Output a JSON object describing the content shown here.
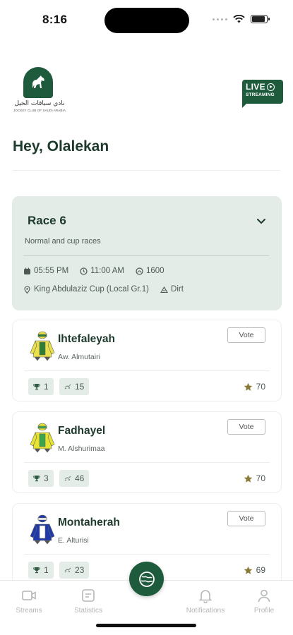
{
  "status_bar": {
    "time": "8:16",
    "battery_level": 0.9
  },
  "header": {
    "logo_arabic": "نادي سباقات الخيل",
    "logo_english": "JOCKEY CLUB OF SAUDI ARABIA",
    "live_label": "LIVE",
    "live_sub": "STREAMING",
    "greeting": "Hey, Olalekan"
  },
  "race": {
    "title": "Race 6",
    "subtitle": "Normal and cup races",
    "date_time": "05:55 PM",
    "time": "11:00 AM",
    "distance": "1600",
    "location": "King Abdulaziz Cup (Local Gr.1)",
    "surface": "Dirt"
  },
  "horses": [
    {
      "name": "Ihtefaleyah",
      "jockey": "Aw. Almutairi",
      "wins": "1",
      "rides": "15",
      "rating": "70",
      "vote_label": "Vote",
      "silk_color": "#e9e04c",
      "silk_accent": "#2e7d32"
    },
    {
      "name": "Fadhayel",
      "jockey": "M. Alshurimaa",
      "wins": "3",
      "rides": "46",
      "rating": "70",
      "vote_label": "Vote",
      "silk_color": "#e6e332",
      "silk_accent": "#3aa64a"
    },
    {
      "name": "Montaherah",
      "jockey": "E. Alturisi",
      "wins": "1",
      "rides": "23",
      "rating": "69",
      "vote_label": "Vote",
      "silk_color": "#1f3aa8",
      "silk_accent": "#ffffff"
    }
  ],
  "nav": {
    "streams": "Streams",
    "statistics": "Statistics",
    "notifications": "Notifications",
    "profile": "Profile"
  },
  "colors": {
    "brand": "#1e5a3c",
    "card_tint": "#e3ece7",
    "star": "#8a7a3a"
  }
}
